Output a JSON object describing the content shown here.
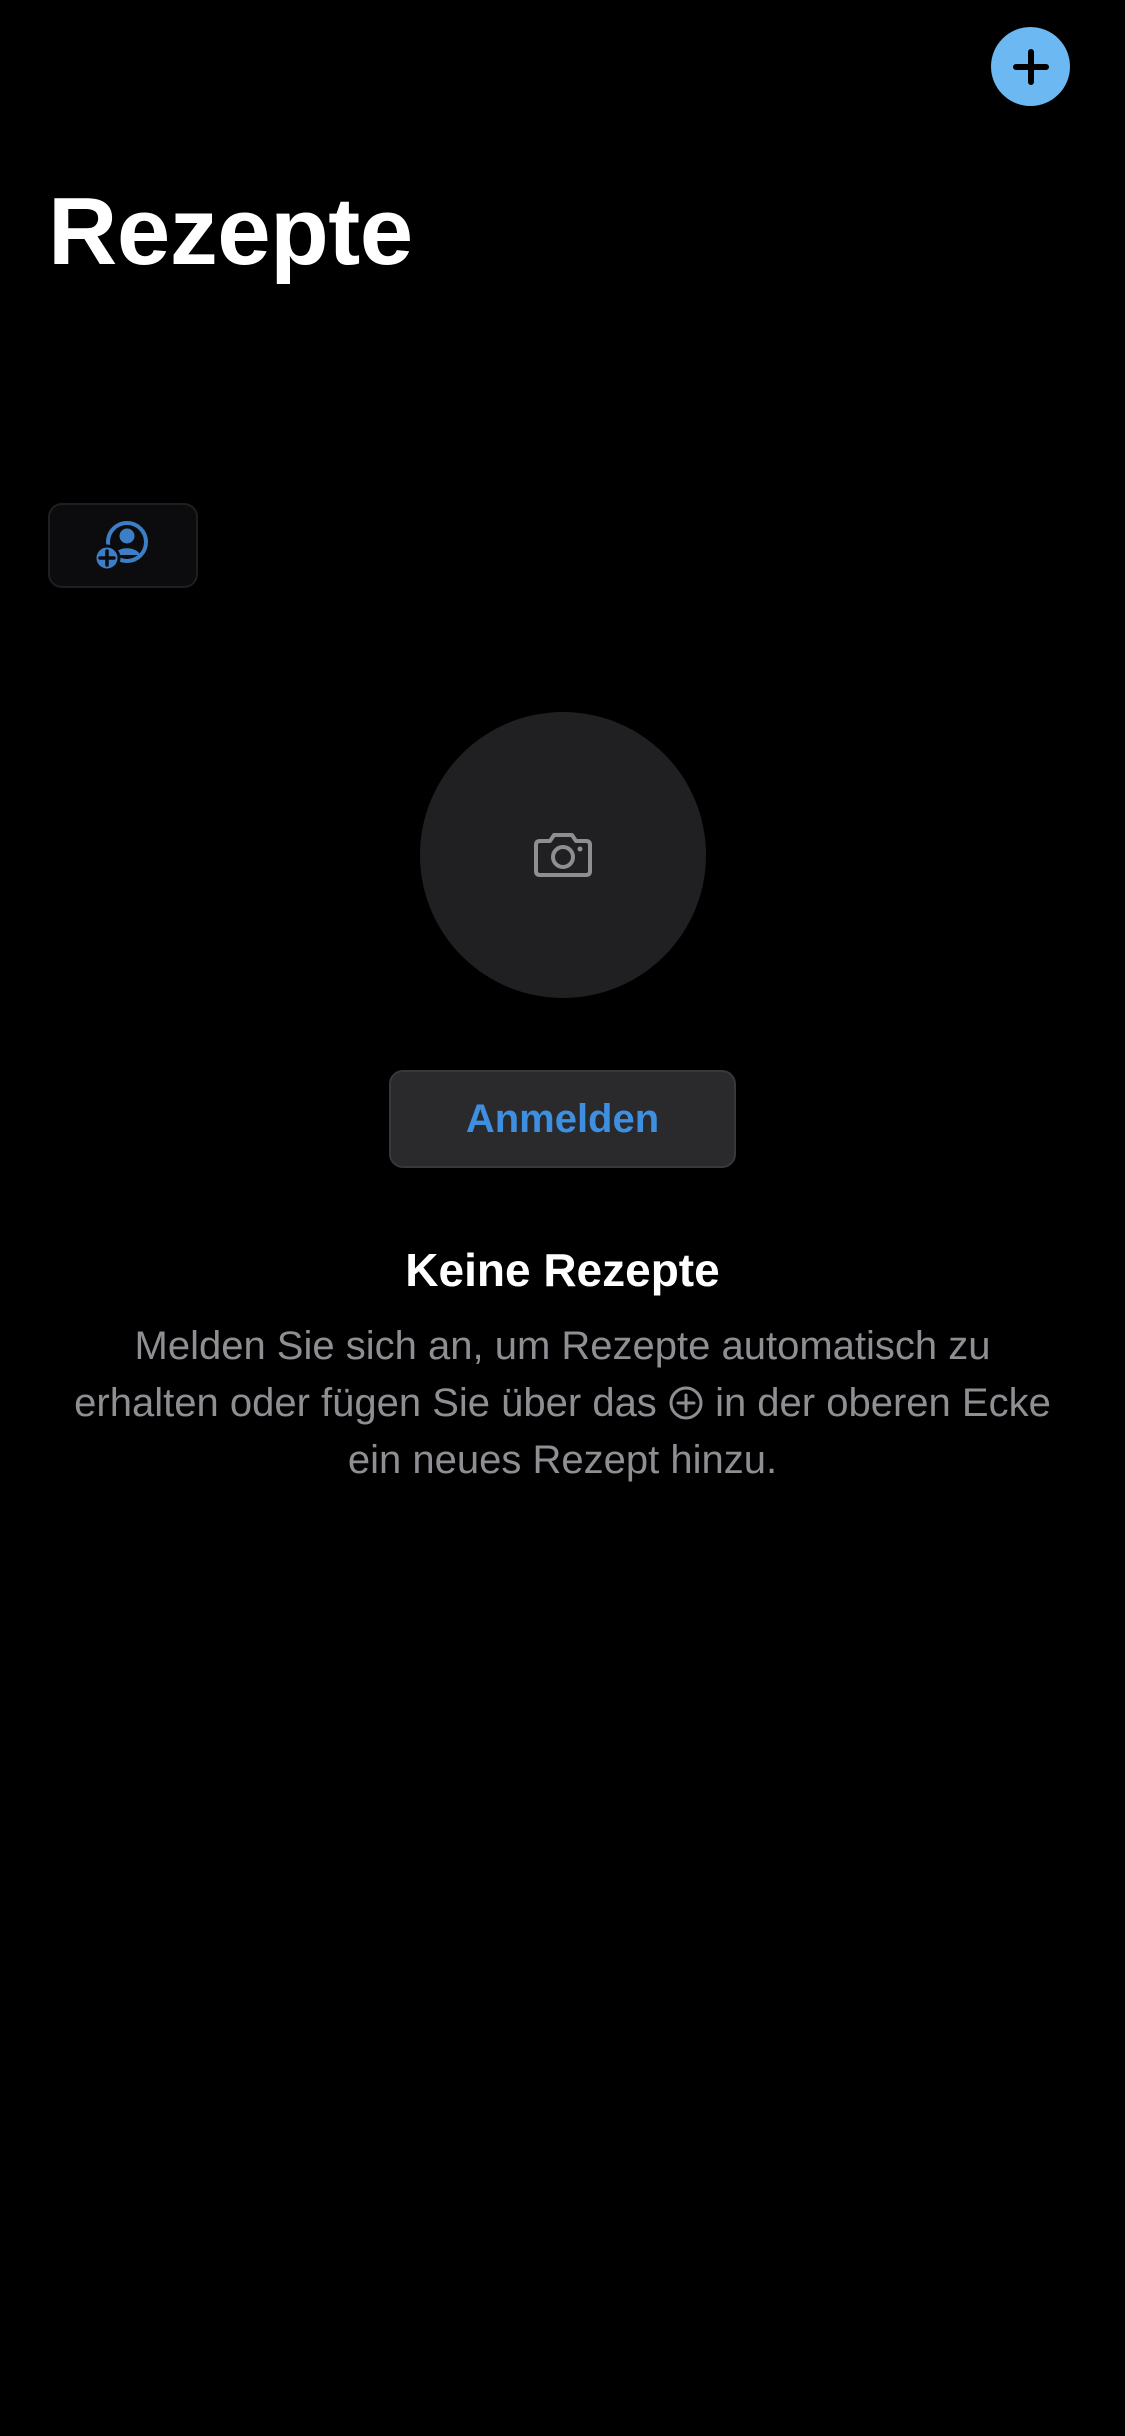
{
  "header": {
    "title": "Rezepte",
    "add_button_icon": "plus-circle-icon"
  },
  "toolbar": {
    "share_button_icon": "person-add-icon"
  },
  "empty_state": {
    "photo_icon": "camera-icon",
    "login_label": "Anmelden",
    "title": "Keine Rezepte",
    "message_part1": "Melden Sie sich an, um Rezepte automatisch zu erhalten oder fügen Sie über das",
    "message_icon": "plus-circle-icon",
    "message_part2": "in der oberen Ecke ein neues Rezept hinzu."
  },
  "colors": {
    "background": "#000000",
    "accent": "#6cb8f2",
    "link_blue": "#3e8fe0",
    "secondary_text": "#8e8e93",
    "circle_bg": "#202022"
  }
}
